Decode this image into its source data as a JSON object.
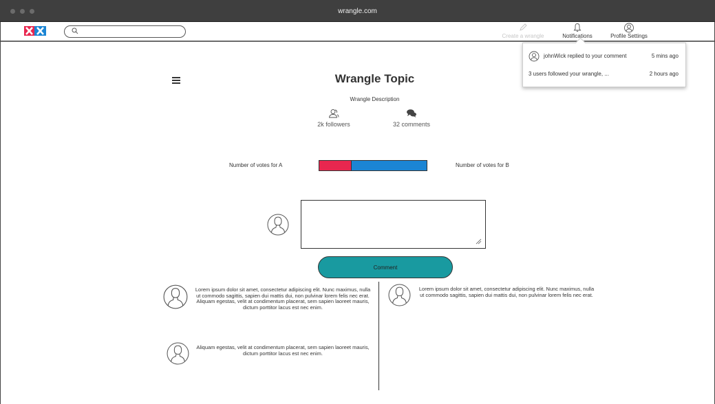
{
  "browser": {
    "url": "wrangle.com"
  },
  "header": {
    "search": {
      "placeholder": ""
    },
    "create_label": "Create a wrangle",
    "notifications_label": "Notifications",
    "profile_label": "Profile Settings"
  },
  "notifications": [
    {
      "text": "johnWick replied to your comment",
      "time": "5 mins ago"
    },
    {
      "text": "3 users followed your wrangle, ...",
      "time": "2 hours ago"
    }
  ],
  "topic": {
    "title": "Wrangle Topic",
    "description": "Wrangle Description",
    "followers": "2k followers",
    "comments": "32 comments"
  },
  "votes": {
    "label_a": "Number of votes for A",
    "label_b": "Number of votes for B",
    "share_a": 0.3,
    "share_b": 0.7,
    "color_a": "#e8274f",
    "color_b": "#1b85d4"
  },
  "comment_form": {
    "value": "",
    "button_label": "Comment",
    "button_color": "#199aa0"
  },
  "comments": [
    {
      "text": "Lorem ipsum dolor sit amet, consectetur adipiscing elit. Nunc maximus, nulla ut commodo sagittis, sapien dui mattis dui, non pulvinar lorem felis nec erat. Aliquam egestas, velit at condimentum placerat, sem sapien laoreet mauris, dictum porttitor lacus est nec enim."
    },
    {
      "text": "Lorem ipsum dolor sit amet, consectetur adipiscing elit. Nunc maximus, nulla ut commodo sagittis, sapien dui mattis dui, non pulvinar lorem felis nec erat."
    },
    {
      "text": "Aliquam egestas, velit at condimentum placerat, sem sapien laoreet mauris, dictum porttitor lacus est nec enim."
    }
  ],
  "icons": {
    "logo": "logo-icon",
    "search": "search-icon",
    "create": "pencil-icon",
    "notifications": "bell-icon",
    "profile": "user-icon",
    "followers": "followers-icon",
    "comments": "chat-icon",
    "menu": "hamburger-icon"
  }
}
